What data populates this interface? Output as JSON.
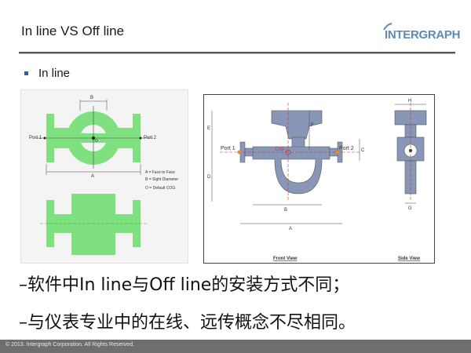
{
  "slide": {
    "title": "In line VS Off line",
    "logo_text": "INTERGRAPH",
    "bullet": "In line",
    "line1": "–软件中In line与Off line的安装方式不同；",
    "line2": "–与仪表专业中的在线、远传概念不尽相同。",
    "footer": "© 2013. Intergraph Corporation. All Rights Reserved."
  },
  "left_figure": {
    "port1": "Port 1",
    "port2": "Port 2",
    "dim_a": "A",
    "dim_b": "B",
    "label_o": "O",
    "legend_a": "A = Face to Face",
    "legend_b": "B = Sight Diameter",
    "legend_o": "O = Default COG"
  },
  "right_figure": {
    "port1": "Port 1",
    "port2": "Port 2",
    "cog": "CoG",
    "dim_a": "A",
    "dim_b": "B",
    "dim_c": "C",
    "dim_d": "D",
    "dim_e": "E",
    "dim_f": "F",
    "dim_g": "G",
    "dim_h": "H",
    "front_view": "Front View",
    "side_view": "Side View"
  },
  "colors": {
    "green": "#7ee07e",
    "green_dark": "#3aa83a",
    "blue_gray": "#8896b8",
    "bullet": "#2a62a8",
    "logo": "#5b8bb8"
  }
}
